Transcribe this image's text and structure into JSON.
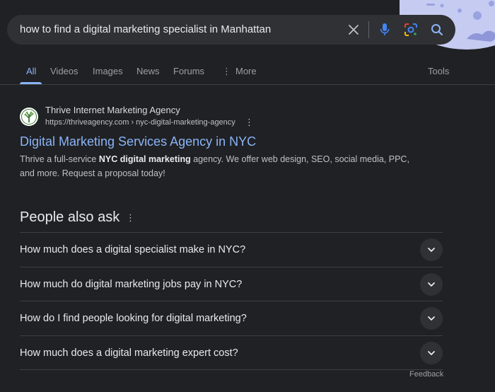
{
  "search": {
    "query": "how to find a digital marketing specialist in Manhattan"
  },
  "tabs": [
    {
      "label": "All",
      "active": true
    },
    {
      "label": "Videos"
    },
    {
      "label": "Images"
    },
    {
      "label": "News"
    },
    {
      "label": "Forums"
    },
    {
      "label": "More",
      "icon": "more-vert-icon"
    }
  ],
  "tools_label": "Tools",
  "result": {
    "site_name": "Thrive Internet Marketing Agency",
    "url": "https://thriveagency.com › nyc-digital-marketing-agency",
    "title": "Digital Marketing Services Agency in NYC",
    "snippet_pre": "Thrive a full-service ",
    "snippet_bold": "NYC digital marketing",
    "snippet_post": " agency. We offer web design, SEO, social media, PPC, and more. Request a proposal today!"
  },
  "paa": {
    "heading": "People also ask",
    "questions": [
      "How much does a digital specialist make in NYC?",
      "How much do digital marketing jobs pay in NYC?",
      "How do I find people looking for digital marketing?",
      "How much does a digital marketing expert cost?"
    ]
  },
  "feedback_label": "Feedback",
  "colors": {
    "background": "#202124",
    "link": "#8ab4f8",
    "search_bar": "#303134",
    "doodle": "#c6cbf2"
  }
}
